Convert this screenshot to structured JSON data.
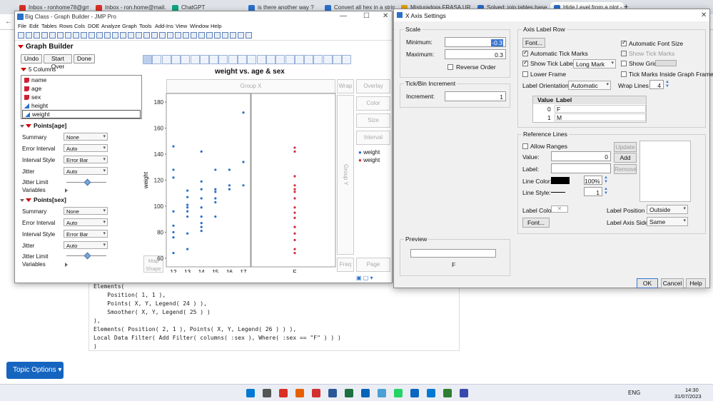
{
  "browser": {
    "tabs": [
      {
        "label": "Inbox - ronhome78@gmail",
        "color": "#d93025"
      },
      {
        "label": "Inbox - ron.home@mail.h",
        "color": "#d93025"
      },
      {
        "label": "ChatGPT",
        "color": "#10a37f"
      },
      {
        "label": "is there another way ?",
        "color": "#2a6fc9"
      },
      {
        "label": "Convert all hex in a string",
        "color": "#2a6fc9"
      },
      {
        "label": "Misturadora FRASA URILO",
        "color": "#e8a200"
      },
      {
        "label": "Solved: join tables based o",
        "color": "#2a6fc9"
      },
      {
        "label": "Hide Level from a plot - JMP",
        "color": "#2a6fc9"
      }
    ]
  },
  "jmp": {
    "title": "Big Class - Graph Builder - JMP Pro",
    "menu": [
      "File",
      "Edit",
      "Tables",
      "Rows",
      "Cols",
      "DOE",
      "Analyze",
      "Graph",
      "Tools",
      "Add-Ins",
      "View",
      "Window",
      "Help"
    ],
    "header": "Graph Builder",
    "buttons": {
      "undo": "Undo",
      "start_over": "Start Over",
      "done": "Done"
    },
    "columns_label": "5 Columns",
    "columns": [
      "name",
      "age",
      "sex",
      "height",
      "weight"
    ],
    "points_age": {
      "title": "Points[age]",
      "rows": [
        {
          "label": "Summary",
          "value": "None"
        },
        {
          "label": "Error Interval",
          "value": "Auto"
        },
        {
          "label": "Interval Style",
          "value": "Error Bar"
        },
        {
          "label": "Jitter",
          "value": "Auto"
        }
      ],
      "jitter_limit": "Jitter Limit",
      "variables": "Variables"
    },
    "points_sex": {
      "title": "Points[sex]",
      "rows": [
        {
          "label": "Summary",
          "value": "None"
        },
        {
          "label": "Error Interval",
          "value": "Auto"
        },
        {
          "label": "Interval Style",
          "value": "Error Bar"
        },
        {
          "label": "Jitter",
          "value": "Auto"
        }
      ],
      "jitter_limit": "Jitter Limit",
      "variables": "Variables"
    },
    "graph": {
      "title": "weight vs. age & sex",
      "group_x": "Group X",
      "wrap": "Wrap",
      "group_y": "Group Y",
      "overlay": "Overlay",
      "color": "Color",
      "size": "Size",
      "interval": "Interval",
      "freq": "Freq",
      "page": "Page",
      "map_shape": "Map Shape",
      "ylabel": "weight",
      "yticks": [
        "180",
        "160",
        "140",
        "120",
        "100",
        "80",
        "60"
      ],
      "age_ticks": [
        "12",
        "13",
        "14",
        "15",
        "16",
        "17"
      ],
      "age_label": "age",
      "sex_ticks": [
        "F"
      ],
      "sex_label": "sex",
      "legend": [
        {
          "name": "weight",
          "color": "#2a6fc9"
        },
        {
          "name": "weight",
          "color": "#d22d3c"
        }
      ]
    }
  },
  "chart_data": [
    {
      "type": "scatter",
      "title": "weight vs. age & sex",
      "xlabel": "age",
      "ylabel": "weight",
      "ylim": [
        55,
        185
      ],
      "categories": [
        "12",
        "13",
        "14",
        "15",
        "16",
        "17"
      ],
      "series": [
        {
          "name": "weight",
          "color": "#2a6fc9",
          "points": [
            [
              12,
              64
            ],
            [
              12,
              76
            ],
            [
              12,
              80
            ],
            [
              12,
              85
            ],
            [
              12,
              96
            ],
            [
              12,
              122
            ],
            [
              12,
              128
            ],
            [
              12,
              146
            ],
            [
              13,
              67
            ],
            [
              13,
              79
            ],
            [
              13,
              92
            ],
            [
              13,
              96
            ],
            [
              13,
              99
            ],
            [
              13,
              101
            ],
            [
              13,
              107
            ],
            [
              13,
              112
            ],
            [
              14,
              81
            ],
            [
              14,
              84
            ],
            [
              14,
              87
            ],
            [
              14,
              92
            ],
            [
              14,
              99
            ],
            [
              14,
              106
            ],
            [
              14,
              113
            ],
            [
              14,
              119
            ],
            [
              14,
              142
            ],
            [
              15,
              92
            ],
            [
              15,
              103
            ],
            [
              15,
              106
            ],
            [
              15,
              111
            ],
            [
              15,
              113
            ],
            [
              15,
              128
            ],
            [
              16,
              113
            ],
            [
              16,
              116
            ],
            [
              16,
              128
            ],
            [
              17,
              116
            ],
            [
              17,
              134
            ],
            [
              17,
              172
            ]
          ]
        }
      ]
    },
    {
      "type": "scatter",
      "xlabel": "sex",
      "categories": [
        "F"
      ],
      "series": [
        {
          "name": "weight",
          "color": "#d22d3c",
          "points": [
            [
              "F",
              64
            ],
            [
              "F",
              67
            ],
            [
              "F",
              74
            ],
            [
              "F",
              79
            ],
            [
              "F",
              84
            ],
            [
              "F",
              84
            ],
            [
              "F",
              91
            ],
            [
              "F",
              95
            ],
            [
              "F",
              99
            ],
            [
              "F",
              106
            ],
            [
              "F",
              111
            ],
            [
              "F",
              113
            ],
            [
              "F",
              116
            ],
            [
              "F",
              123
            ],
            [
              "F",
              142
            ],
            [
              "F",
              145
            ]
          ]
        }
      ]
    }
  ],
  "dialog": {
    "title": "X Axis Settings",
    "scale": {
      "label": "Scale",
      "minimum_label": "Minimum:",
      "minimum": "-0.3",
      "maximum_label": "Maximum:",
      "maximum": "0.3",
      "reverse_order": "Reverse Order"
    },
    "tick": {
      "label": "Tick/Bin Increment",
      "increment_label": "Increment:",
      "increment": "1"
    },
    "axis_label_row": {
      "label": "Axis Label Row",
      "font": "Font...",
      "automatic_font_size": "Automatic Font Size",
      "automatic_tick_marks": "Automatic Tick Marks",
      "show_tick_marks": "Show Tick Marks",
      "show_tick_labels": "Show Tick Labels",
      "tick_label_style": "Long Mark",
      "show_grid": "Show Grid",
      "lower_frame": "Lower Frame",
      "inside_frame": "Tick Marks Inside Graph Frame",
      "orientation_label": "Label Orientation",
      "orientation": "Automatic",
      "wrap_lines_label": "Wrap Lines",
      "wrap_lines": "4",
      "table_header": [
        "Value",
        "Label"
      ],
      "rows": [
        {
          "value": "0",
          "label": "F"
        },
        {
          "value": "1",
          "label": "M"
        }
      ]
    },
    "reference_lines": {
      "label": "Reference Lines",
      "allow_ranges": "Allow Ranges",
      "value_label": "Value:",
      "value": "0",
      "label_label": "Label:",
      "line_color_label": "Line Color:",
      "opacity": "100%",
      "line_style_label": "Line Style:",
      "line_width": "1",
      "update": "Update",
      "add": "Add",
      "remove": "Remove",
      "label_color": "Label Color",
      "label_position_label": "Label Position",
      "label_position": "Outside",
      "font": "Font...",
      "label_axis_side_label": "Label Axis Side",
      "label_axis_side": "Same"
    },
    "preview": {
      "label": "Preview",
      "tick": "F"
    },
    "ok": "OK",
    "cancel": "Cancel",
    "help": "Help"
  },
  "code_lines": [
    "Elements(",
    "    Position( 1, 1 ),",
    "    Points( X, Y, Legend( 24 ) ),",
    "    Smoother( X, Y, Legend( 25 ) )",
    "),",
    "Elements( Position( 2, 1 ), Points( X, Y, Legend( 26 ) ) ),",
    "Local Data Filter( Add Filter( columns( :sex ), Where( :sex == \"F\" ) ) )",
    ")"
  ],
  "topic_options": "Topic Options",
  "taskbar": {
    "lang": "ENG",
    "time": "14:30",
    "date": "31/07/2023"
  }
}
